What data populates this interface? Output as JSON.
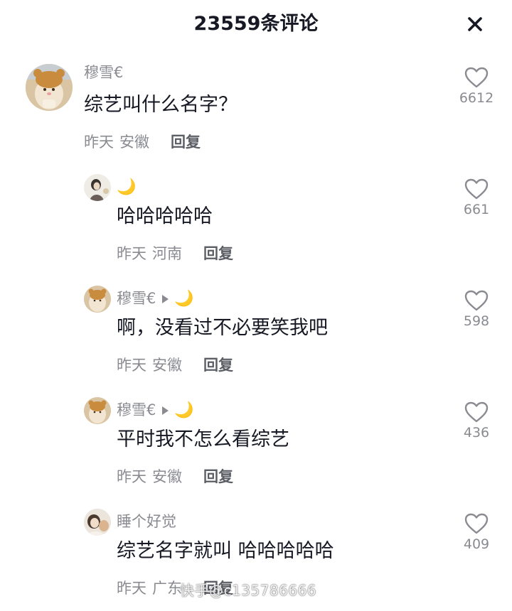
{
  "header": {
    "title": "23559条评论",
    "close_icon": "close-icon"
  },
  "comments": [
    {
      "user": "穆雪€",
      "text": "综艺叫什么名字？",
      "time": "昨天",
      "location": "安徽",
      "reply_label": "回复",
      "likes": "6612"
    }
  ],
  "replies": [
    {
      "user": "",
      "moon": "🌙",
      "text": "哈哈哈哈哈",
      "time": "昨天",
      "location": "河南",
      "reply_label": "回复",
      "likes": "661"
    },
    {
      "user": "穆雪€",
      "moon": "🌙",
      "text": "啊，没看过不必要笑我吧",
      "time": "昨天",
      "location": "安徽",
      "reply_label": "回复",
      "likes": "598"
    },
    {
      "user": "穆雪€",
      "moon": "🌙",
      "text": "平时我不怎么看综艺",
      "time": "昨天",
      "location": "安徽",
      "reply_label": "回复",
      "likes": "436"
    },
    {
      "user": "睡个好觉",
      "text": "综艺名字就叫 哈哈哈哈哈",
      "time": "昨天",
      "location": "广东",
      "reply_label": "回复",
      "likes": "409"
    }
  ],
  "watermark": "快手@c135786666",
  "colors": {
    "primary_text": "#161823",
    "secondary_text": "#8a8b91",
    "reply_text": "#5c5e66",
    "moon": "#f3c33a"
  }
}
